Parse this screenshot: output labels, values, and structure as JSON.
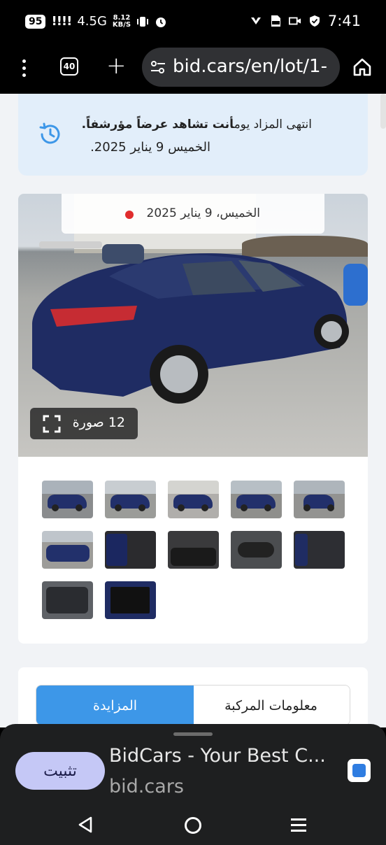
{
  "status_bar": {
    "battery": "95",
    "signal": "!!!!",
    "network": "4.5G",
    "speed_value": "8.12",
    "speed_unit": "KB/S",
    "time": "7:41",
    "icons": [
      "vibrate-icon",
      "alarm-icon",
      "app-icon",
      "pdf-icon",
      "video-icon",
      "shield-icon"
    ]
  },
  "browser": {
    "tab_count": "40",
    "url": "bid.cars/en/lot/1-"
  },
  "notice": {
    "line1_normal": "انتهى المزاد يوم",
    "line1_bold": "أنت تشاهد عرضاً مؤرشفاً.",
    "line2": "الخميس 9 يناير 2025."
  },
  "photo": {
    "date_text": "الخميس، 9 يناير 2025",
    "count_text": "12 صورة",
    "thumbnail_count": 12
  },
  "tabs": {
    "vehicle": "معلومات المركبة",
    "auction": "المزايدة"
  },
  "install_sheet": {
    "button": "تثبيت",
    "app_title": "BidCars - Your Best C...",
    "app_domain": "bid.cars"
  },
  "colors": {
    "accent_blue": "#3d97e8",
    "notice_bg": "#e2eefa",
    "install_button": "#c5c8f6",
    "live_dot": "#e02d2d"
  }
}
